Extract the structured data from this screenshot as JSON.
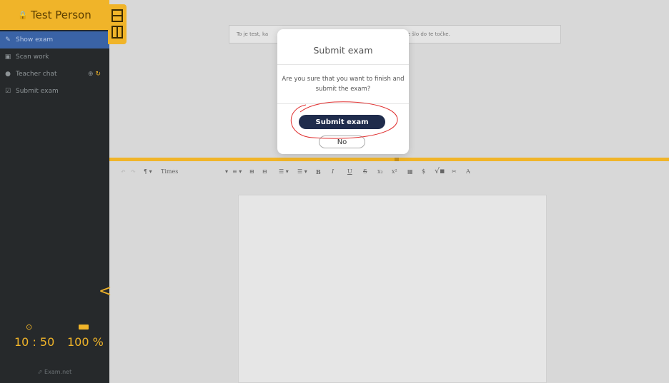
{
  "sidebar": {
    "user_name": "Test Person",
    "items": [
      {
        "label": "Show exam",
        "icon": "edit-icon",
        "active": true
      },
      {
        "label": "Scan work",
        "icon": "camera-icon",
        "active": false
      },
      {
        "label": "Teacher chat",
        "icon": "chat-icon",
        "active": false
      },
      {
        "label": "Submit exam",
        "icon": "checkbox-icon",
        "active": false
      }
    ],
    "timer": "10 : 50",
    "battery": "100 %",
    "brand": "Exam.net"
  },
  "exam": {
    "text_left": "To je test, ka",
    "text_right": "ako je šlo do te točke."
  },
  "toolbar": {
    "font_name": "Times",
    "bold": "B",
    "italic": "I",
    "underline": "U",
    "strike": "S",
    "subscript": "x₂",
    "superscript": "x²",
    "dollar": "$"
  },
  "modal": {
    "title": "Submit exam",
    "message": "Are you sure that you want to finish and submit the exam?",
    "submit_label": "Submit exam",
    "no_label": "No"
  },
  "colors": {
    "accent": "#f0b429",
    "sidebar_bg": "#26292b",
    "active_item": "#3a63a6",
    "primary_button": "#1f2c4c",
    "annotation": "#e03030"
  }
}
